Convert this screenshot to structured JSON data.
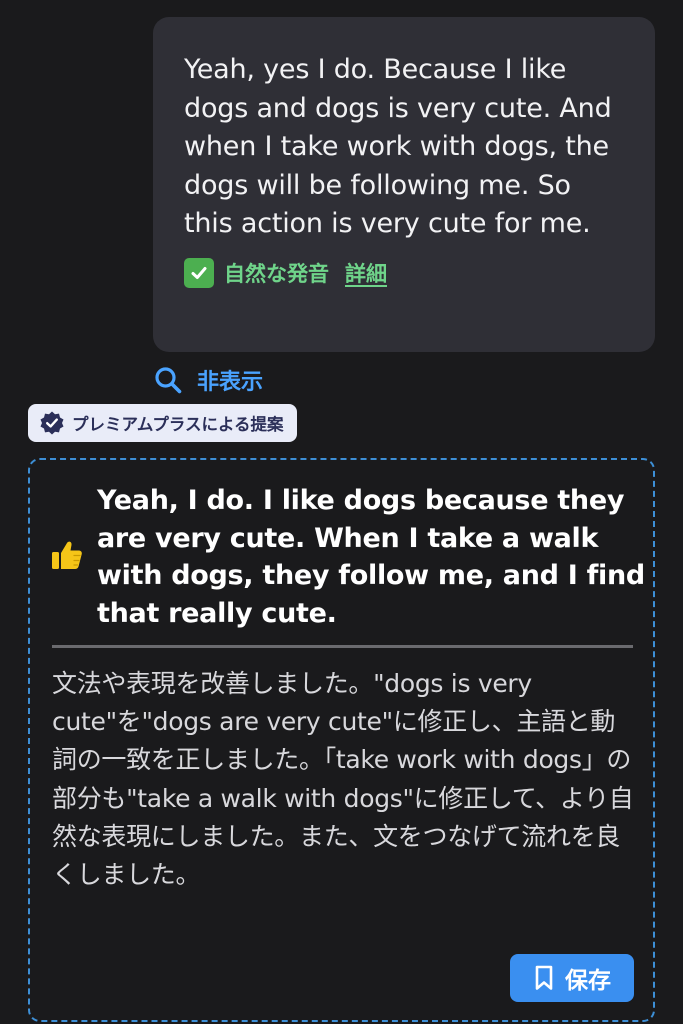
{
  "user_message": {
    "text": "Yeah, yes I do. Because I like dogs and dogs is very cute. And when I take work with dogs, the dogs will be following me. So this action is very cute for me.",
    "pronunciation_label": "自然な発音",
    "detail_link": "詳細",
    "check_icon": "check-box-icon"
  },
  "hide_toggle": {
    "label": "非表示",
    "icon": "search-icon"
  },
  "premium_badge": {
    "label": "プレミアムプラスによる提案",
    "icon": "verified-badge-icon"
  },
  "suggestion": {
    "icon": "thumbs-up-icon",
    "text": "Yeah, I do. I like dogs because they are very cute. When I take a walk with dogs, they follow me, and I find that really cute.",
    "explanation": "文法や表現を改善しました。\"dogs is very cute\"を\"dogs are very cute\"に修正し、主語と動詞の一致を正しました。「take work with dogs」の部分も\"take a walk with dogs\"に修正して、より自然な表現にしました。また、文をつなげて流れを良くしました。",
    "save_label": "保存",
    "save_icon": "bookmark-icon"
  },
  "colors": {
    "background": "#1a1a1c",
    "bubble": "#2f2f36",
    "accent_green": "#6fd48a",
    "accent_blue": "#4aa3ff",
    "save_button": "#3a8ff0",
    "badge_bg": "#e9ecf8",
    "card_border": "#3d8fd6"
  }
}
